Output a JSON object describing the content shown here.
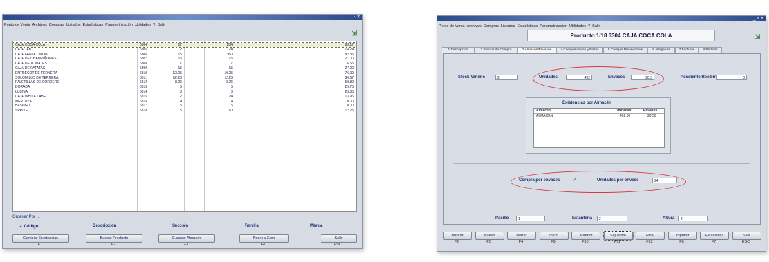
{
  "left": {
    "menu": [
      "Punto de Venta",
      "Archivos",
      "Compras",
      "Listados",
      "Estadísticas",
      "Parametrización",
      "Utilidades",
      "?",
      "Salir"
    ],
    "rows": [
      {
        "name": "CAJA COCA COLA",
        "code": "6304",
        "q1": "17",
        "q2": "254",
        "amt": "93.17"
      },
      {
        "name": "CAJA JAB",
        "code": "6305",
        "q1": "2",
        "q2": "24",
        "amt": "14.24"
      },
      {
        "name": "CAJA FANTA LIMON",
        "code": "6306",
        "q1": "15",
        "q2": "360",
        "amt": "82.35"
      },
      {
        "name": "CAJA DE CHAMPIÑONES",
        "code": "6307",
        "q1": "15",
        "q2": "15",
        "amt": "21.00"
      },
      {
        "name": "CAJA DE TOMATES",
        "code": "6308",
        "q1": "7",
        "q2": "7",
        "amt": "6.65"
      },
      {
        "name": "CAJA DE PATATAS",
        "code": "6309",
        "q1": "15",
        "q2": "15",
        "amt": "27.00"
      },
      {
        "name": "ENTRECOT DE TERNERA",
        "code": "6310",
        "q1": "10.25",
        "q2": "10.25",
        "amt": "76.99"
      },
      {
        "name": "SOLOMILLO DE TERNERA",
        "code": "6311",
        "q1": "12.23",
        "q2": "12.23",
        "amt": "86.67"
      },
      {
        "name": "PALETILLAS DE CORDERO",
        "code": "6312",
        "q1": "8.26",
        "q2": "8.26",
        "amt": "50.80"
      },
      {
        "name": "DORADA",
        "code": "6313",
        "q1": "5",
        "q2": "5",
        "amt": "29.75"
      },
      {
        "name": "LUBINA",
        "code": "6314",
        "q1": "3",
        "q2": "3",
        "amt": "23.85"
      },
      {
        "name": "CAJA WHITE LABEL",
        "code": "6315",
        "q1": "2",
        "q2": "24",
        "amt": "13.96"
      },
      {
        "name": "MERLUZA",
        "code": "6316",
        "q1": "4",
        "q2": "4",
        "amt": "0.00"
      },
      {
        "name": "BESUGO",
        "code": "6317",
        "q1": "5",
        "q2": "5",
        "amt": "0.00"
      },
      {
        "name": "SPRITE",
        "code": "6318",
        "q1": "5",
        "q2": "60",
        "amt": "12.25"
      }
    ],
    "order_title": "Ordenar Por ...",
    "order_opts": [
      "Código",
      "Descripción",
      "Sección",
      "Familia",
      "Marca"
    ],
    "buttons": [
      {
        "label": "Cambiar Existencias",
        "key": "F1"
      },
      {
        "label": "Buscar Producto",
        "key": "F2"
      },
      {
        "label": "Guardar Almacén",
        "key": "F3"
      },
      {
        "label": "Poner a Cero",
        "key": "F4"
      },
      {
        "label": "Salir",
        "key": "ESC"
      }
    ]
  },
  "right": {
    "menu": [
      "Punto de Venta",
      "Archivos",
      "Compras",
      "Listados",
      "Estadísticas",
      "Parametrización",
      "Utilidades",
      "?",
      "Salir"
    ],
    "product_title": "Producto 1/18  6304  CAJA COCA COLA",
    "tabs": [
      "1 Descripción",
      "2 Precios de Compra",
      "3 Almacén/Envases",
      "4 Composiciones y Platos",
      "5 Códigos Proveedores",
      "6 Alérgenos",
      "7 Facturas",
      "8 Pedidos"
    ],
    "stock_min_label": "Stock Mínimo",
    "stock_min": "2",
    "unidades_label": "Unidades",
    "unidades": "492",
    "envases_label": "Envases",
    "envases": "20.5",
    "pend_label": "Pendiente Recibir",
    "pend": "0",
    "exist_title": "Existencias por Almacén",
    "exist_headers": [
      "Almacén",
      "Unidades",
      "Envases"
    ],
    "exist_row": [
      "ALMACEN",
      "492.00",
      "20.50"
    ],
    "compra_label": "Compra por envases",
    "compra_check": "✓",
    "unid_env_label": "Unidades por envase",
    "unid_env": "24",
    "pasillo_label": "Pasillo",
    "pasillo": "1",
    "estanteria_label": "Estantería",
    "estanteria": "2",
    "altura_label": "Altura",
    "altura": "2",
    "buttons": [
      {
        "label": "Buscar",
        "key": "F2"
      },
      {
        "label": "Nuevo",
        "key": "F5"
      },
      {
        "label": "Borrar",
        "key": "F4"
      },
      {
        "label": "Inicio",
        "key": "F9"
      },
      {
        "label": "Anterior",
        "key": "F10"
      },
      {
        "label": "Siguiente",
        "key": "F11"
      },
      {
        "label": "Final",
        "key": "F12"
      },
      {
        "label": "Imprimir",
        "key": "F8"
      },
      {
        "label": "Estadística",
        "key": "F7"
      },
      {
        "label": "Salir",
        "key": "ESC"
      }
    ]
  }
}
